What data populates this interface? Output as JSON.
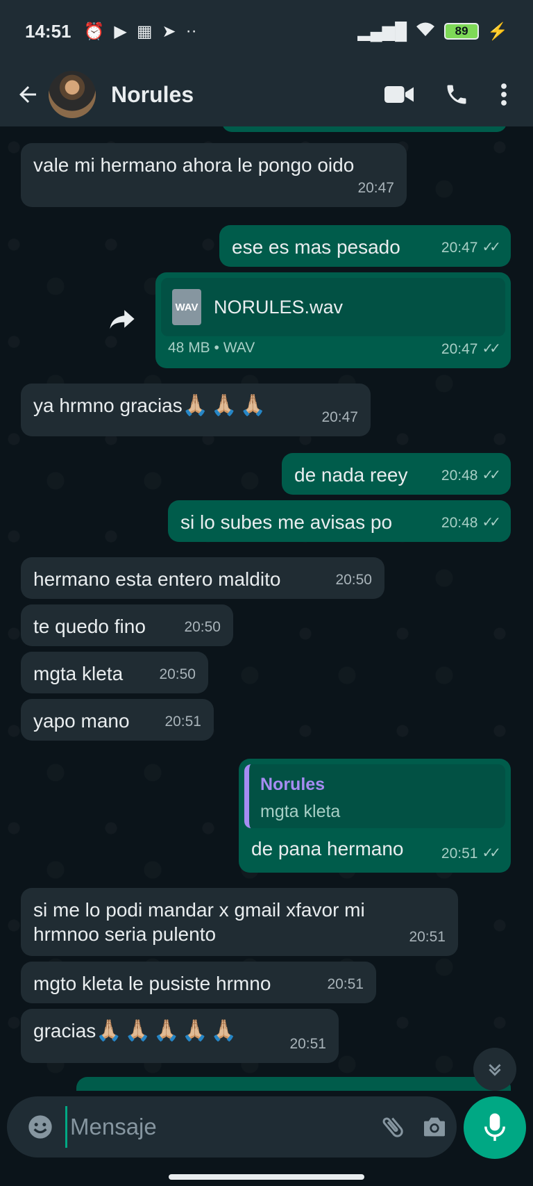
{
  "status_bar": {
    "time": "14:51",
    "battery": "89"
  },
  "header": {
    "contact_name": "Norules"
  },
  "messages": [
    {
      "text": "vale mi hermano ahora le pongo oido",
      "time": "20:47"
    },
    {
      "text": "ese es mas pesado",
      "time": "20:47"
    },
    {
      "file_name": "NORULES.wav",
      "file_type": "WAV",
      "file_meta": "48 MB • WAV",
      "time": "20:47"
    },
    {
      "text": "ya hrmno gracias",
      "emoji": "🙏🏼🙏🏼🙏🏼",
      "time": "20:47"
    },
    {
      "text": "de nada reey",
      "time": "20:48"
    },
    {
      "text": "si lo subes me avisas po",
      "time": "20:48"
    },
    {
      "text": "hermano esta entero maldito",
      "time": "20:50"
    },
    {
      "text": "te quedo fino",
      "time": "20:50"
    },
    {
      "text": "mgta kleta",
      "time": "20:50"
    },
    {
      "text": "yapo mano",
      "time": "20:51"
    },
    {
      "quote_author": "Norules",
      "quote_text": "mgta kleta",
      "text": "de pana hermano",
      "time": "20:51"
    },
    {
      "text": "si me lo podi mandar x gmail xfavor mi hrmnoo seria pulento",
      "time": "20:51"
    },
    {
      "text": "mgto kleta le pusiste hrmno",
      "time": "20:51"
    },
    {
      "text": "gracias",
      "emoji": "🙏🏼🙏🏼🙏🏼🙏🏼🙏🏼",
      "time": "20:51"
    }
  ],
  "composer": {
    "placeholder": "Mensaje"
  },
  "colors": {
    "incoming_bubble": "#202c33",
    "outgoing_bubble": "#005c4b",
    "accent": "#00a884",
    "quote_author": "#a68cf2"
  },
  "icons": [
    "back-arrow-icon",
    "video-call-icon",
    "phone-icon",
    "more-vert-icon",
    "forward-icon",
    "emoji-icon",
    "attach-icon",
    "camera-icon",
    "mic-icon",
    "chevron-down-icon"
  ]
}
